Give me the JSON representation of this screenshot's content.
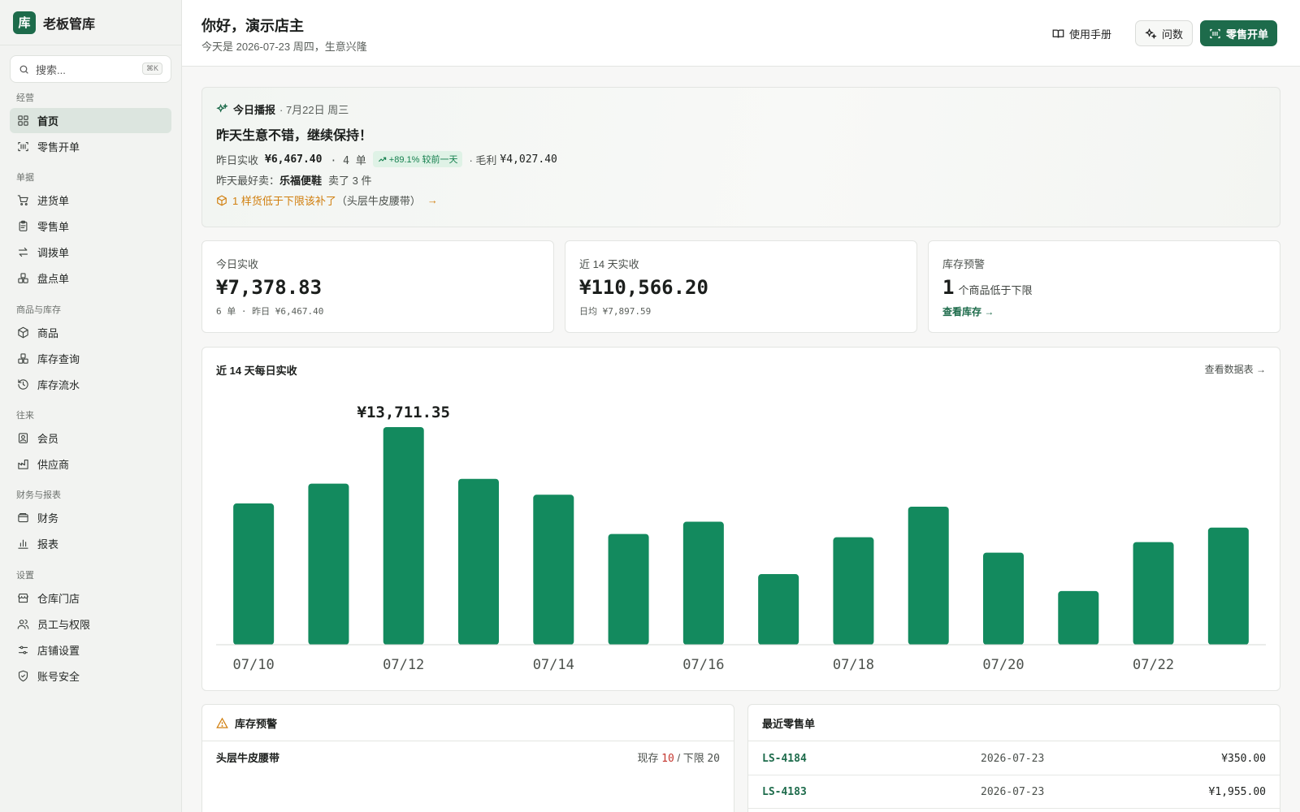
{
  "brand": {
    "logo": "库",
    "name": "老板管库"
  },
  "search": {
    "placeholder": "搜索...",
    "shortcut": "⌘K"
  },
  "nav": [
    {
      "title": "经营",
      "items": [
        {
          "label": "首页",
          "icon": "home-grid-icon",
          "active": true
        },
        {
          "label": "零售开单",
          "icon": "scan-icon"
        }
      ]
    },
    {
      "title": "单据",
      "items": [
        {
          "label": "进货单",
          "icon": "cart-icon"
        },
        {
          "label": "零售单",
          "icon": "clipboard-icon"
        },
        {
          "label": "调拨单",
          "icon": "transfer-icon"
        },
        {
          "label": "盘点单",
          "icon": "boxes-icon"
        }
      ]
    },
    {
      "title": "商品与库存",
      "items": [
        {
          "label": "商品",
          "icon": "package-icon"
        },
        {
          "label": "库存查询",
          "icon": "boxes-icon"
        },
        {
          "label": "库存流水",
          "icon": "history-icon"
        }
      ]
    },
    {
      "title": "往来",
      "items": [
        {
          "label": "会员",
          "icon": "member-card-icon"
        },
        {
          "label": "供应商",
          "icon": "factory-icon"
        }
      ]
    },
    {
      "title": "财务与报表",
      "items": [
        {
          "label": "财务",
          "icon": "wallet-icon"
        },
        {
          "label": "报表",
          "icon": "bar-chart-icon"
        }
      ]
    },
    {
      "title": "设置",
      "items": [
        {
          "label": "仓库门店",
          "icon": "store-icon"
        },
        {
          "label": "员工与权限",
          "icon": "users-icon"
        },
        {
          "label": "店铺设置",
          "icon": "sliders-icon"
        },
        {
          "label": "账号安全",
          "icon": "shield-icon"
        }
      ]
    }
  ],
  "header": {
    "greeting": "你好，演示店主",
    "subtitle": "今天是 2026-07-23 周四，生意兴隆",
    "manual_label": "使用手册",
    "ask_label": "问数",
    "pos_label": "零售开单"
  },
  "broadcast": {
    "title": "今日播报",
    "date": "· 7月22日 周三",
    "headline": "昨天生意不错，继续保持！",
    "line1_prefix": "昨日实收",
    "line1_amount": "¥6,467.40",
    "line1_orders": "· 4 单",
    "line1_badge": "+89.1% 较前一天",
    "line1_profit_label": "· 毛利",
    "line1_profit": "¥4,027.40",
    "line2_prefix": "昨天最好卖：",
    "line2_product": "乐福便鞋",
    "line2_suffix": "卖了 3 件",
    "line3_warn": "1 样货低于下限该补了",
    "line3_detail": "（头层牛皮腰带）",
    "line3_arrow": "→"
  },
  "stats": {
    "today_label": "今日实收",
    "today_value": "¥7,378.83",
    "today_sub": "6 单 · 昨日 ¥6,467.40",
    "d14_label": "近 14 天实收",
    "d14_value": "¥110,566.20",
    "d14_sub": "日均 ¥7,897.59",
    "alert_label": "库存预警",
    "alert_count": "1",
    "alert_unit": "个商品低于下限",
    "alert_link": "查看库存 →"
  },
  "chart_panel": {
    "title": "近 14 天每日实收",
    "link": "查看数据表 →"
  },
  "chart_data": {
    "type": "bar",
    "title": "近 14 天每日实收",
    "categories": [
      "07/10",
      "07/11",
      "07/12",
      "07/13",
      "07/14",
      "07/15",
      "07/16",
      "07/17",
      "07/18",
      "07/19",
      "07/20",
      "07/21",
      "07/22",
      "07/23"
    ],
    "tick_labels": [
      "07/10",
      "07/12",
      "07/14",
      "07/16",
      "07/18",
      "07/20",
      "07/22"
    ],
    "values": [
      8900,
      10150,
      13711.35,
      10450,
      9450,
      6980,
      7750,
      4450,
      6770,
      8700,
      5800,
      3380,
      6467.4,
      7378.83
    ],
    "highlight_label": "¥13,711.35",
    "color": "#138a5e",
    "ylim": [
      0,
      13711.35
    ],
    "grid": false
  },
  "stock_alert": {
    "title": "库存预警",
    "items": [
      {
        "name": "头层牛皮腰带",
        "stock_label": "现存",
        "stock": "10",
        "sep": "/",
        "limit_label": "下限",
        "limit": "20"
      }
    ]
  },
  "recent_sales": {
    "title": "最近零售单",
    "rows": [
      {
        "no": "LS-4184",
        "date": "2026-07-23",
        "amount": "¥350.00"
      },
      {
        "no": "LS-4183",
        "date": "2026-07-23",
        "amount": "¥1,955.00"
      }
    ]
  }
}
